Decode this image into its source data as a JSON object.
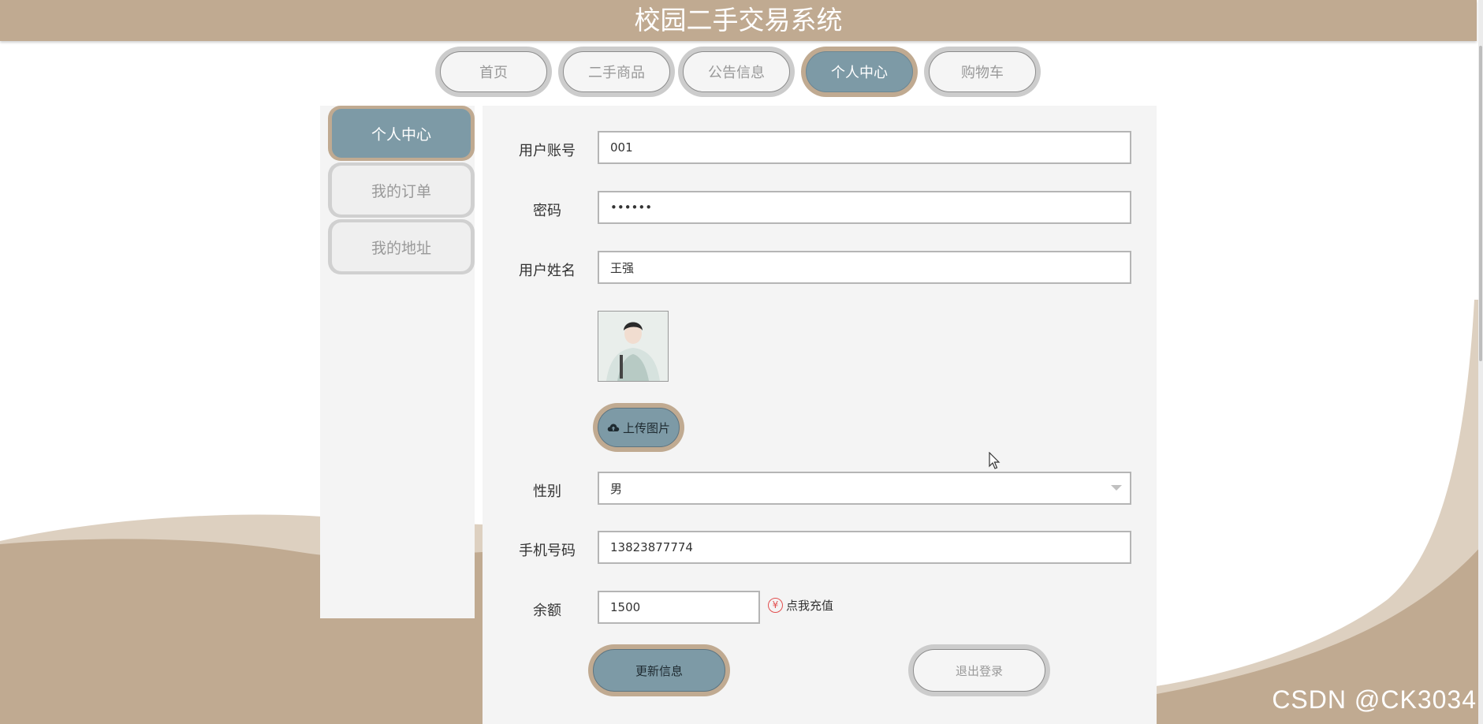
{
  "header": {
    "title": "校园二手交易系统",
    "bg_color": "#c0aa91"
  },
  "nav": {
    "items": [
      {
        "label": "首页",
        "active": false
      },
      {
        "label": "二手商品",
        "active": false
      },
      {
        "label": "公告信息",
        "active": false
      },
      {
        "label": "个人中心",
        "active": true
      },
      {
        "label": "购物车",
        "active": false
      }
    ]
  },
  "sidebar": {
    "items": [
      {
        "label": "个人中心",
        "active": true
      },
      {
        "label": "我的订单",
        "active": false
      },
      {
        "label": "我的地址",
        "active": false
      }
    ]
  },
  "form": {
    "account": {
      "label": "用户账号",
      "value": "001"
    },
    "password": {
      "label": "密码",
      "value": "••••••"
    },
    "name": {
      "label": "用户姓名",
      "value": "王强"
    },
    "avatar_icon": "user-photo",
    "upload_button": "上传图片",
    "gender": {
      "label": "性别",
      "value": "男"
    },
    "phone": {
      "label": "手机号码",
      "value": "13823877774"
    },
    "balance": {
      "label": "余额",
      "value": "1500"
    },
    "recharge": {
      "icon": "yen-icon",
      "label": "点我充值"
    },
    "update_button": "更新信息",
    "logout_button": "退出登录"
  },
  "watermark": "CSDN @CK3034",
  "colors": {
    "accent": "#7d9aa6",
    "brand": "#c0aa91",
    "panel": "#f4f4f4"
  }
}
